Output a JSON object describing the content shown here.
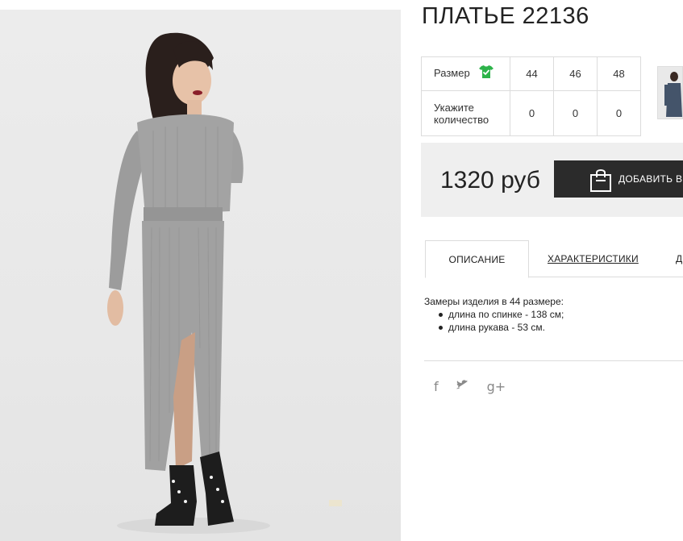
{
  "product": {
    "title": "ПЛАТЬЕ 22136"
  },
  "size_table": {
    "size_label": "Размер",
    "qty_label_line1": "Укажите",
    "qty_label_line2": "количество",
    "sizes": [
      "44",
      "46",
      "48"
    ],
    "quantities": [
      "0",
      "0",
      "0"
    ]
  },
  "buy": {
    "price": "1320 руб",
    "cart_label": "ДОБАВИТЬ В"
  },
  "tabs": {
    "description": "ОПИСАНИЕ",
    "characteristics": "ХАРАКТЕРИСТИКИ",
    "third": "Д"
  },
  "description": {
    "intro": "Замеры изделия в 44 размере:",
    "items": [
      "длина по спинке - 138 см;",
      "длина рукава - 53 см."
    ]
  },
  "social": {
    "facebook": "f",
    "twitter": "twitter-icon",
    "google_plus": "g+"
  },
  "colors": {
    "check_green": "#2db34a",
    "button_dark": "#2b2b2b",
    "buy_box_bg": "#efefef"
  }
}
